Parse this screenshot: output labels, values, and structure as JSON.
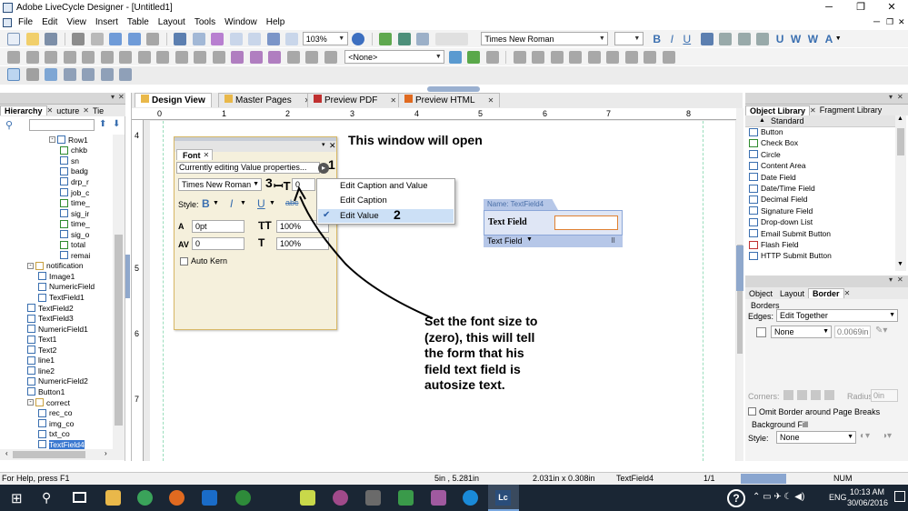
{
  "window": {
    "title": "Adobe LiveCycle Designer - [Untitled1]",
    "min": "─",
    "max": "❐",
    "close": "✕"
  },
  "menu": [
    "File",
    "Edit",
    "View",
    "Insert",
    "Table",
    "Layout",
    "Tools",
    "Window",
    "Help"
  ],
  "toolbar": {
    "zoom": "103%",
    "font": "Times New Roman",
    "size": "",
    "style_none": "<None>"
  },
  "left_panel": {
    "tabs": [
      "Hierarchy",
      "ucture",
      "Tie"
    ],
    "tree": [
      {
        "label": "Row1",
        "indent": 3,
        "pm": "-",
        "icon": "#3a6fb0"
      },
      {
        "label": "chkb",
        "indent": 4,
        "icon": "#2e8b2e"
      },
      {
        "label": "sn",
        "indent": 4,
        "icon": "#3a6fb0"
      },
      {
        "label": "badg",
        "indent": 4,
        "icon": "#3a6fb0"
      },
      {
        "label": "drp_r",
        "indent": 4,
        "icon": "#3a6fb0"
      },
      {
        "label": "job_c",
        "indent": 4,
        "icon": "#3a6fb0"
      },
      {
        "label": "time_",
        "indent": 4,
        "icon": "#2e8b2e"
      },
      {
        "label": "sig_ir",
        "indent": 4,
        "icon": "#3a6fb0"
      },
      {
        "label": "time_",
        "indent": 4,
        "icon": "#2e8b2e"
      },
      {
        "label": "sig_o",
        "indent": 4,
        "icon": "#3a6fb0"
      },
      {
        "label": "total",
        "indent": 4,
        "icon": "#2e8b2e"
      },
      {
        "label": "remai",
        "indent": 4,
        "icon": "#3a6fb0"
      },
      {
        "label": "notification",
        "indent": 1,
        "pm": "-",
        "icon": "#c8a040"
      },
      {
        "label": "Image1",
        "indent": 2,
        "icon": "#3a6fb0"
      },
      {
        "label": "NumericField",
        "indent": 2,
        "icon": "#3a6fb0"
      },
      {
        "label": "TextField1",
        "indent": 2,
        "icon": "#3a6fb0"
      },
      {
        "label": "TextField2",
        "indent": 1,
        "icon": "#3a6fb0"
      },
      {
        "label": "TextField3",
        "indent": 1,
        "icon": "#3a6fb0"
      },
      {
        "label": "NumericField1",
        "indent": 1,
        "icon": "#3a6fb0"
      },
      {
        "label": "Text1",
        "indent": 1,
        "icon": "#3a6fb0"
      },
      {
        "label": "Text2",
        "indent": 1,
        "icon": "#3a6fb0"
      },
      {
        "label": "line1",
        "indent": 1,
        "icon": "#3a6fb0"
      },
      {
        "label": "line2",
        "indent": 1,
        "icon": "#3a6fb0"
      },
      {
        "label": "NumericField2",
        "indent": 1,
        "icon": "#3a6fb0"
      },
      {
        "label": "Button1",
        "indent": 1,
        "icon": "#3a6fb0"
      },
      {
        "label": "correct",
        "indent": 1,
        "pm": "-",
        "icon": "#c8a040"
      },
      {
        "label": "rec_co",
        "indent": 2,
        "icon": "#3a6fb0"
      },
      {
        "label": "img_co",
        "indent": 2,
        "icon": "#3a6fb0"
      },
      {
        "label": "txt_co",
        "indent": 2,
        "icon": "#3a6fb0"
      },
      {
        "label": "TextField4",
        "indent": 2,
        "icon": "#3a6fb0",
        "selected": true
      }
    ]
  },
  "doc_tabs": [
    "Design View",
    "Master Pages",
    "Preview PDF",
    "Preview HTML"
  ],
  "ruler": [
    "0",
    "1",
    "2",
    "3",
    "4",
    "5",
    "6",
    "7",
    "8"
  ],
  "vruler": [
    "4",
    "5",
    "6",
    "7"
  ],
  "font_palette": {
    "title": "Font",
    "editing": "Currently editing Value properties...",
    "font_name": "Times New Roman",
    "size": "0",
    "style_label": "Style:",
    "baseline": "0pt",
    "h_scale": "100%",
    "kerning": "0",
    "v_scale": "100%",
    "auto_kern": "Auto Kern"
  },
  "context_menu": [
    "Edit Caption and Value",
    "Edit Caption",
    "Edit Value"
  ],
  "annotations": {
    "n1": "1",
    "n2": "2",
    "n3": "3",
    "window_note": "This window will open",
    "note": "Set the font size to (zero), this will tell the form that his field text field is autosize text."
  },
  "field": {
    "name": "Name: TextField4",
    "caption": "Text Field",
    "type": "Text Field"
  },
  "object_library": {
    "tabs": [
      "Object Library",
      "Fragment Library"
    ],
    "group": "Standard",
    "items": [
      {
        "label": "Button",
        "color": "#3a6fb0"
      },
      {
        "label": "Check Box",
        "color": "#2e8b2e"
      },
      {
        "label": "Circle",
        "color": "#3a6fb0"
      },
      {
        "label": "Content Area",
        "color": "#3a6fb0"
      },
      {
        "label": "Date Field",
        "color": "#3a6fb0"
      },
      {
        "label": "Date/Time Field",
        "color": "#3a6fb0"
      },
      {
        "label": "Decimal Field",
        "color": "#3a6fb0"
      },
      {
        "label": "Signature Field",
        "color": "#3a6fb0"
      },
      {
        "label": "Drop-down List",
        "color": "#3a6fb0"
      },
      {
        "label": "Email Submit Button",
        "color": "#3a6fb0"
      },
      {
        "label": "Flash Field",
        "color": "#c03030"
      },
      {
        "label": "HTTP Submit Button",
        "color": "#3a6fb0"
      }
    ]
  },
  "props_panel": {
    "tabs": [
      "Object",
      "Layout",
      "Border"
    ],
    "borders": "Borders",
    "edges_label": "Edges:",
    "edges_value": "Edit Together",
    "line_style": "None",
    "thickness": "0.0069in",
    "corners": "Corners:",
    "radius_label": "Radius:",
    "radius": "0in",
    "omit": "Omit Border around Page Breaks",
    "bg": "Background Fill",
    "style_label": "Style:",
    "style_value": "None"
  },
  "statusbar": {
    "help": "For Help, press F1",
    "pos": "5in , 5.281in",
    "size": "2.031in x 0.308in",
    "obj": "TextField4",
    "page": "1/1",
    "num": "NUM"
  },
  "taskbar": {
    "time": "10:13 AM",
    "date": "30/06/2016",
    "lang": "ENG"
  }
}
